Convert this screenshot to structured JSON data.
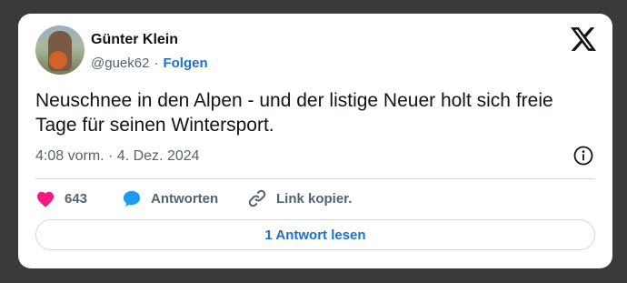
{
  "user": {
    "name": "Günter Klein",
    "handle": "@guek62",
    "separator": "·",
    "follow_label": "Folgen"
  },
  "tweet": {
    "text": "Neuschnee in den Alpen - und der listige Neuer holt sich freie Tage für seinen Wintersport.",
    "timestamp": "4:08 vorm. · 4. Dez. 2024"
  },
  "actions": {
    "likes_count": "643",
    "reply_label": "Antworten",
    "copy_link_label": "Link kopier."
  },
  "replies_button_label": "1 Antwort lesen",
  "colors": {
    "accent": "#1d6fd1",
    "like": "#f91880",
    "text_secondary": "#536471"
  },
  "icons": [
    "x-logo-icon",
    "info-icon",
    "heart-icon",
    "speech-bubble-icon",
    "link-icon"
  ]
}
